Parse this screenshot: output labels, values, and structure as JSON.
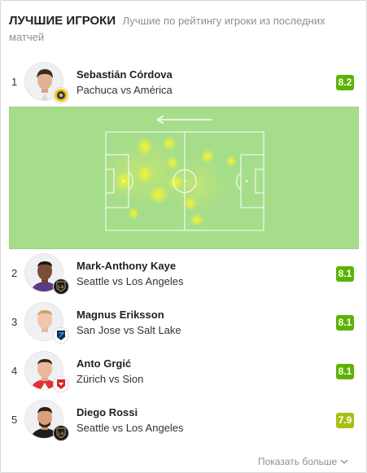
{
  "header": {
    "title": "ЛУЧШИЕ ИГРОКИ",
    "subtitle": "Лучшие по рейтингу игроки из последних матчей"
  },
  "players": [
    {
      "rank": "1",
      "name": "Sebastián Córdova",
      "match": "Pachuca vs América",
      "rating": "8.2",
      "rating_color": "#5cb400"
    },
    {
      "rank": "2",
      "name": "Mark-Anthony Kaye",
      "match": "Seattle vs Los Angeles",
      "rating": "8.1",
      "rating_color": "#5cb400"
    },
    {
      "rank": "3",
      "name": "Magnus Eriksson",
      "match": "San Jose vs Salt Lake",
      "rating": "8.1",
      "rating_color": "#5cb400"
    },
    {
      "rank": "4",
      "name": "Anto Grgić",
      "match": "Zürich vs Sion",
      "rating": "8.1",
      "rating_color": "#5cb400"
    },
    {
      "rank": "5",
      "name": "Diego Rossi",
      "match": "Seattle vs Los Angeles",
      "rating": "7.9",
      "rating_color": "#a9c011"
    }
  ],
  "heatmap": {
    "attack_direction": "left",
    "pitch_color": "#a6dd8b",
    "hotspot_color": "#f2f23a"
  },
  "footer": {
    "show_more": "Показать больше"
  }
}
